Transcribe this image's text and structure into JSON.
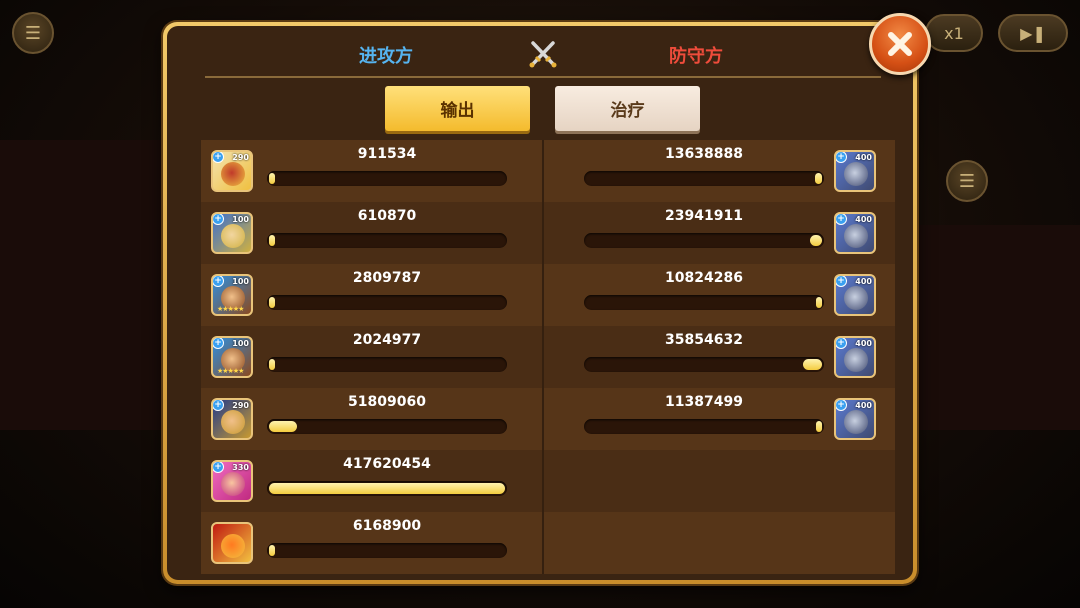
{
  "header": {
    "attack_label": "进攻方",
    "defense_label": "防守方"
  },
  "tabs": {
    "output_label": "输出",
    "heal_label": "治疗",
    "active": "output"
  },
  "background": {
    "speed_label": "x1"
  },
  "attackers": [
    {
      "level": "290",
      "value": "911534",
      "fraction": 0.02,
      "hero": "knight",
      "stars": ""
    },
    {
      "level": "100",
      "value": "610870",
      "fraction": 0.01,
      "hero": "paladin",
      "stars": ""
    },
    {
      "level": "100",
      "value": "2809787",
      "fraction": 0.01,
      "hero": "warrior",
      "stars": "★★★★★"
    },
    {
      "level": "100",
      "value": "2024977",
      "fraction": 0.01,
      "hero": "warrior",
      "stars": "★★★★★"
    },
    {
      "level": "290",
      "value": "51809060",
      "fraction": 0.12,
      "hero": "captain",
      "stars": ""
    },
    {
      "level": "330",
      "value": "417620454",
      "fraction": 1.0,
      "hero": "witch",
      "stars": ""
    },
    {
      "level": "",
      "value": "6168900",
      "fraction": 0.02,
      "hero": "phoenix",
      "stars": ""
    }
  ],
  "defenders": [
    {
      "level": "400",
      "value": "13638888",
      "fraction": 0.03,
      "hero": "robot"
    },
    {
      "level": "400",
      "value": "23941911",
      "fraction": 0.05,
      "hero": "robot"
    },
    {
      "level": "400",
      "value": "10824286",
      "fraction": 0.02,
      "hero": "robot"
    },
    {
      "level": "400",
      "value": "35854632",
      "fraction": 0.08,
      "hero": "robot"
    },
    {
      "level": "400",
      "value": "11387499",
      "fraction": 0.02,
      "hero": "robot"
    }
  ],
  "colors": {
    "attack": "#56b4f0",
    "defense": "#ef4c3b",
    "bar_fill": "#f4cc3f",
    "panel_border": "#e2ae45"
  }
}
